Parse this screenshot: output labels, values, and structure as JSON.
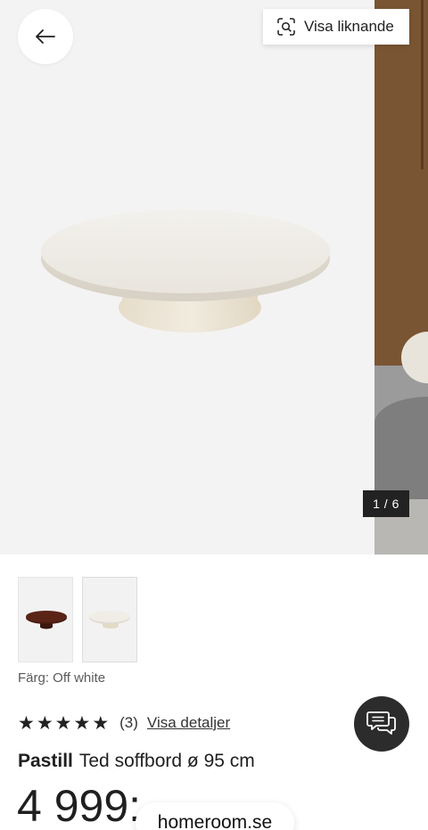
{
  "gallery": {
    "similar_label": "Visa liknande",
    "counter": "1 / 6"
  },
  "product": {
    "color_label": "Färg: Off white",
    "rating_stars": 5,
    "review_count": "(3)",
    "details_link": "Visa detaljer",
    "brand": "Pastill",
    "title": "Ted soffbord ø 95 cm",
    "price": "4 999:-"
  },
  "footer": {
    "domain": "homeroom.se"
  },
  "icons": {
    "back": "arrow-left-icon",
    "similar": "visual-search-icon",
    "star": "star-icon",
    "chat": "chat-bubbles-icon"
  },
  "colors": {
    "counter_bg": "#222222",
    "chat_bg": "#2c2c2c",
    "table_off_white": "#efece6",
    "table_dark_brown": "#4a1c12"
  }
}
